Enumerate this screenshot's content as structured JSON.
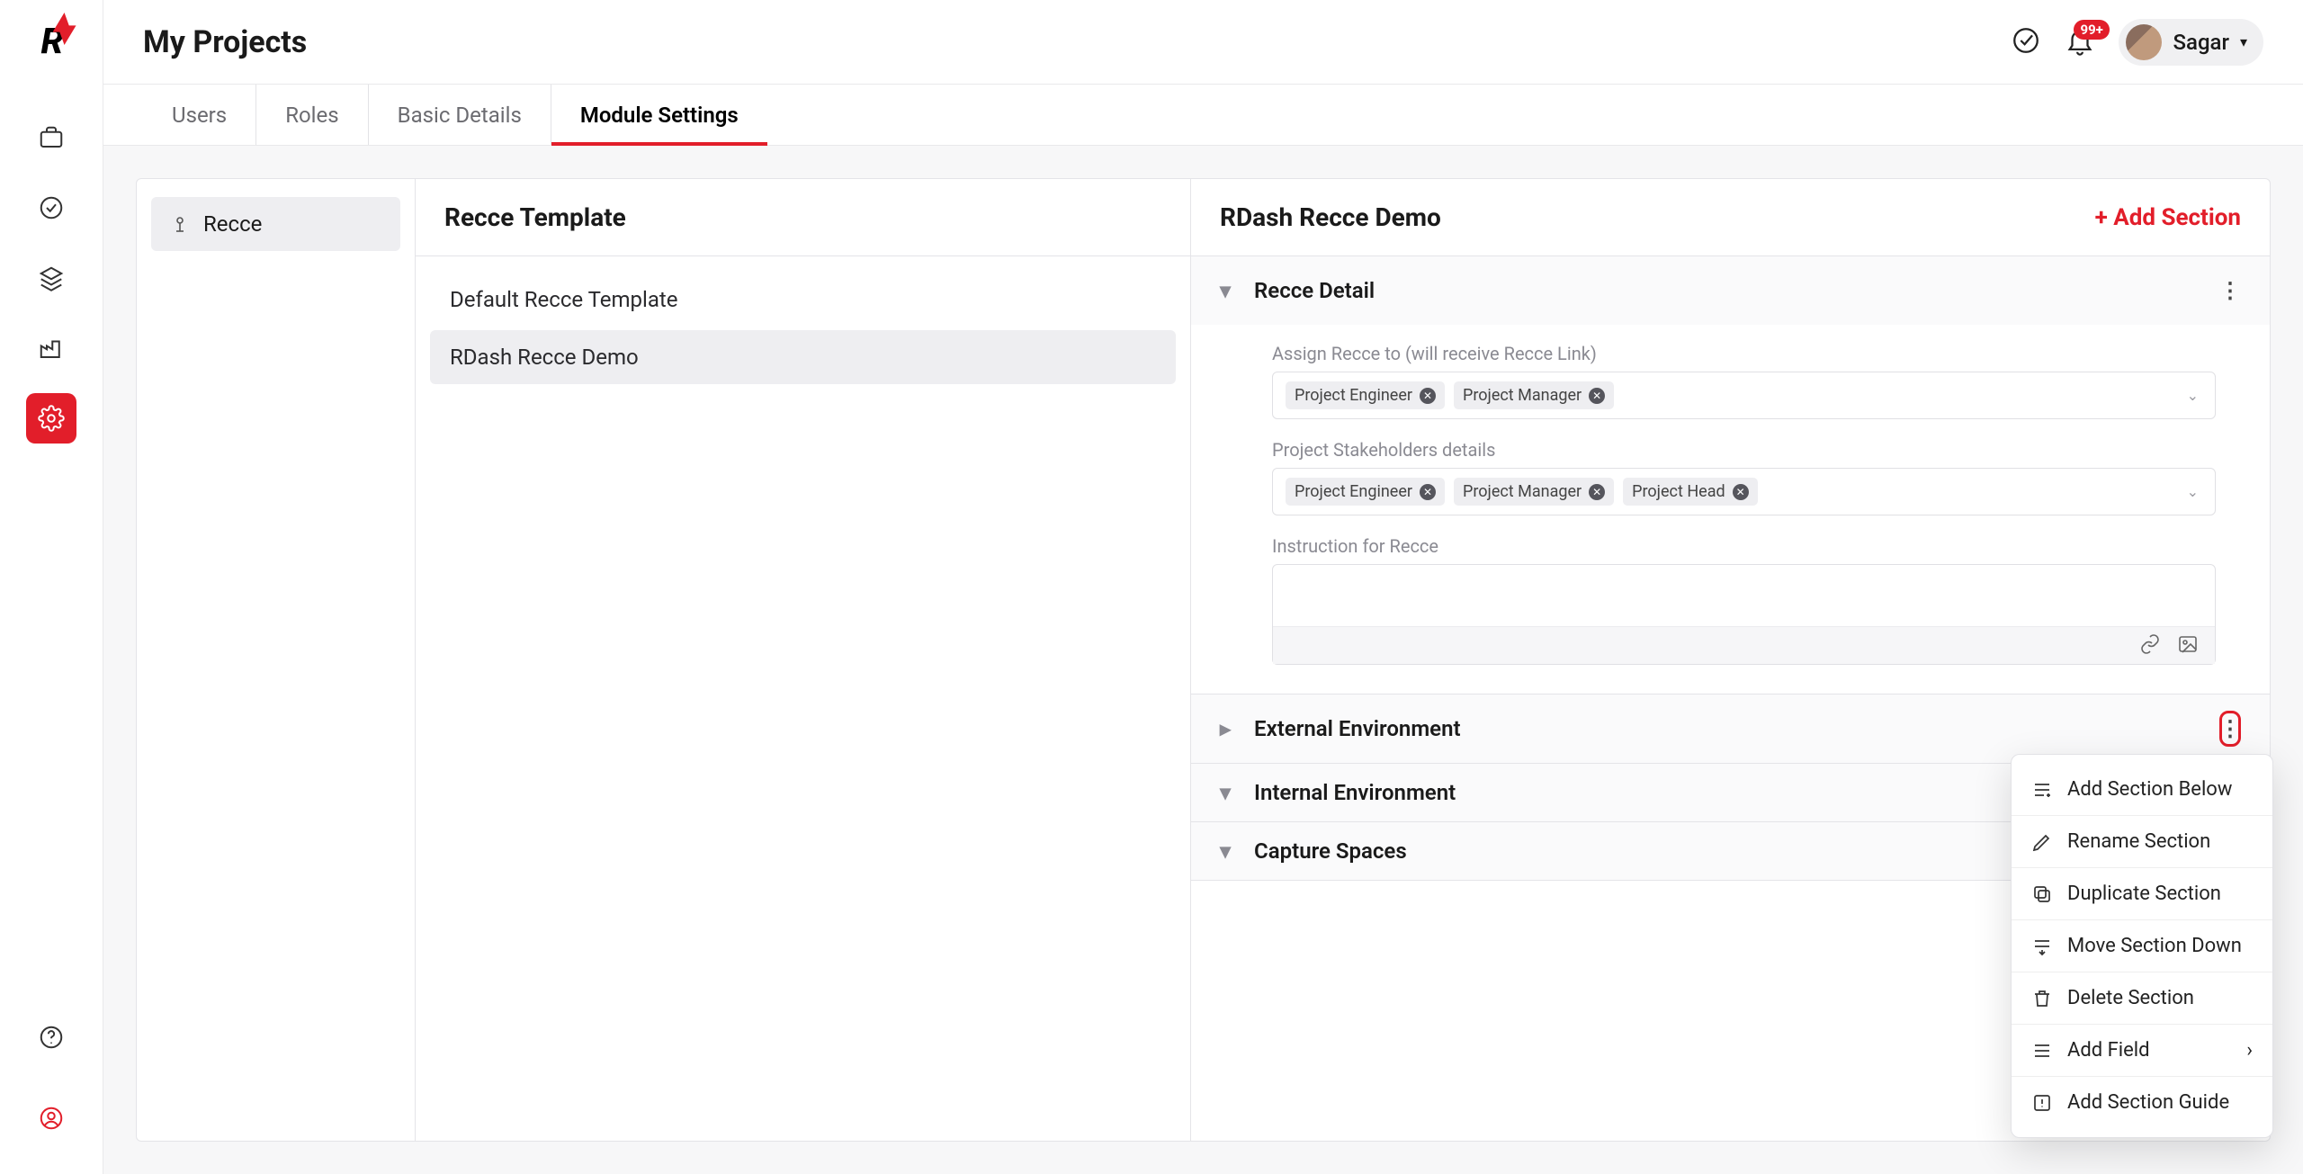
{
  "header": {
    "title": "My Projects",
    "username": "Sagar",
    "notification_badge": "99+"
  },
  "tabs": [
    "Users",
    "Roles",
    "Basic Details",
    "Module Settings"
  ],
  "active_tab": 3,
  "sidebar_module": {
    "label": "Recce"
  },
  "templates": {
    "title": "Recce Template",
    "items": [
      "Default Recce Template",
      "RDash Recce Demo"
    ],
    "active": 1
  },
  "detail": {
    "title": "RDash Recce Demo",
    "add_section_label": "+ Add Section",
    "sections": [
      {
        "name": "Recce Detail",
        "expanded": true
      },
      {
        "name": "External Environment",
        "expanded": false
      },
      {
        "name": "Internal Environment",
        "expanded": false
      },
      {
        "name": "Capture Spaces",
        "expanded": false
      }
    ],
    "fields": {
      "assign_label": "Assign Recce to (will receive Recce Link)",
      "assign_tags": [
        "Project Engineer",
        "Project Manager"
      ],
      "stakeholders_label": "Project Stakeholders details",
      "stakeholder_tags": [
        "Project Engineer",
        "Project Manager",
        "Project Head"
      ],
      "instruction_label": "Instruction for Recce"
    }
  },
  "section_menu": [
    "Add Section Below",
    "Rename Section",
    "Duplicate Section",
    "Move Section Down",
    "Delete Section",
    "Add Field",
    "Add Section Guide"
  ]
}
